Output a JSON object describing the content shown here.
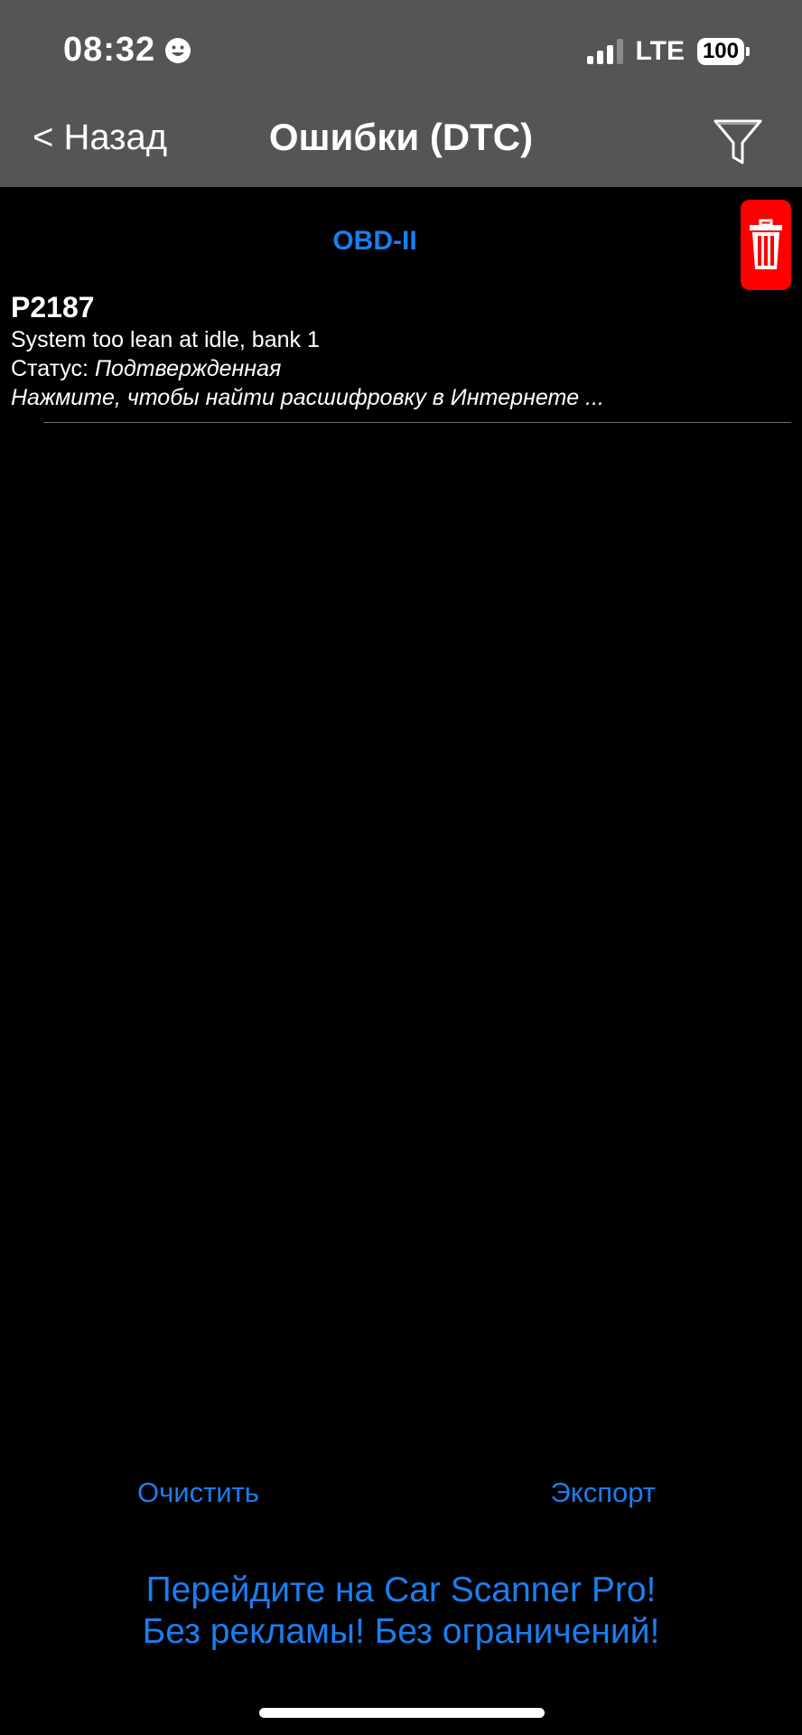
{
  "status_bar": {
    "time": "08:32",
    "network": "LTE",
    "battery": "100"
  },
  "nav": {
    "back_label": "< Назад",
    "title": "Ошибки (DTC)"
  },
  "section": {
    "header": "OBD-II"
  },
  "dtc_list": [
    {
      "code": "P2187",
      "description": "System too lean at idle, bank 1",
      "status_label": "Статус:",
      "status_value": "Подтвержденная",
      "hint": "Нажмите, чтобы найти расшифровку в Интернете ..."
    }
  ],
  "actions": {
    "clear_label": "Очистить",
    "export_label": "Экспорт"
  },
  "promo": {
    "line1": "Перейдите на Car Scanner Pro!",
    "line2": "Без рекламы! Без ограничений!"
  },
  "colors": {
    "header_bg": "#555555",
    "accent": "#1a7ef0",
    "delete": "#ff0000",
    "background": "#000000"
  },
  "icons": {
    "filter": "filter-funnel-icon",
    "delete": "trash-icon",
    "status_emoji": "smiley-icon"
  }
}
